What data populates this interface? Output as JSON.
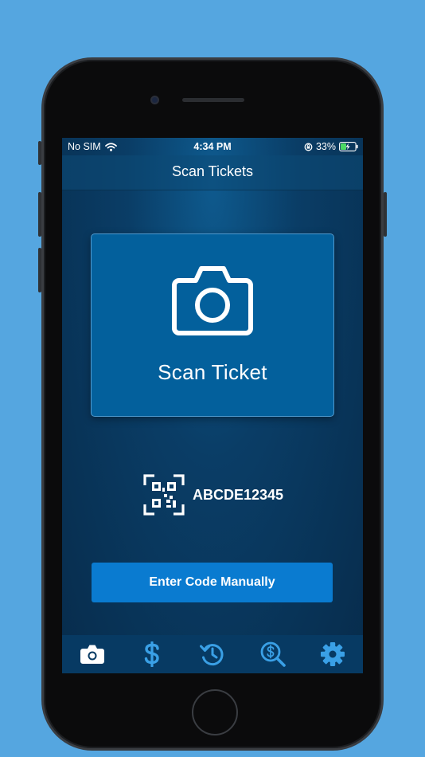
{
  "status_bar": {
    "carrier": "No SIM",
    "time": "4:34 PM",
    "battery": "33%"
  },
  "nav": {
    "title": "Scan Tickets"
  },
  "scan_card": {
    "label": "Scan Ticket",
    "icon": "camera-icon"
  },
  "code_example": {
    "text": "ABCDE12345",
    "icon": "qr-code-icon"
  },
  "manual_button": {
    "label": "Enter Code Manually"
  },
  "tabs": [
    {
      "icon": "camera-icon",
      "active": true
    },
    {
      "icon": "dollar-icon",
      "active": false
    },
    {
      "icon": "history-icon",
      "active": false
    },
    {
      "icon": "search-dollar-icon",
      "active": false
    },
    {
      "icon": "gear-icon",
      "active": false
    }
  ],
  "colors": {
    "background": "#55a6e0",
    "card": "#03609c",
    "button": "#0a7bd0",
    "tab_active": "#ffffff",
    "tab_inactive": "#3aa0e6"
  }
}
